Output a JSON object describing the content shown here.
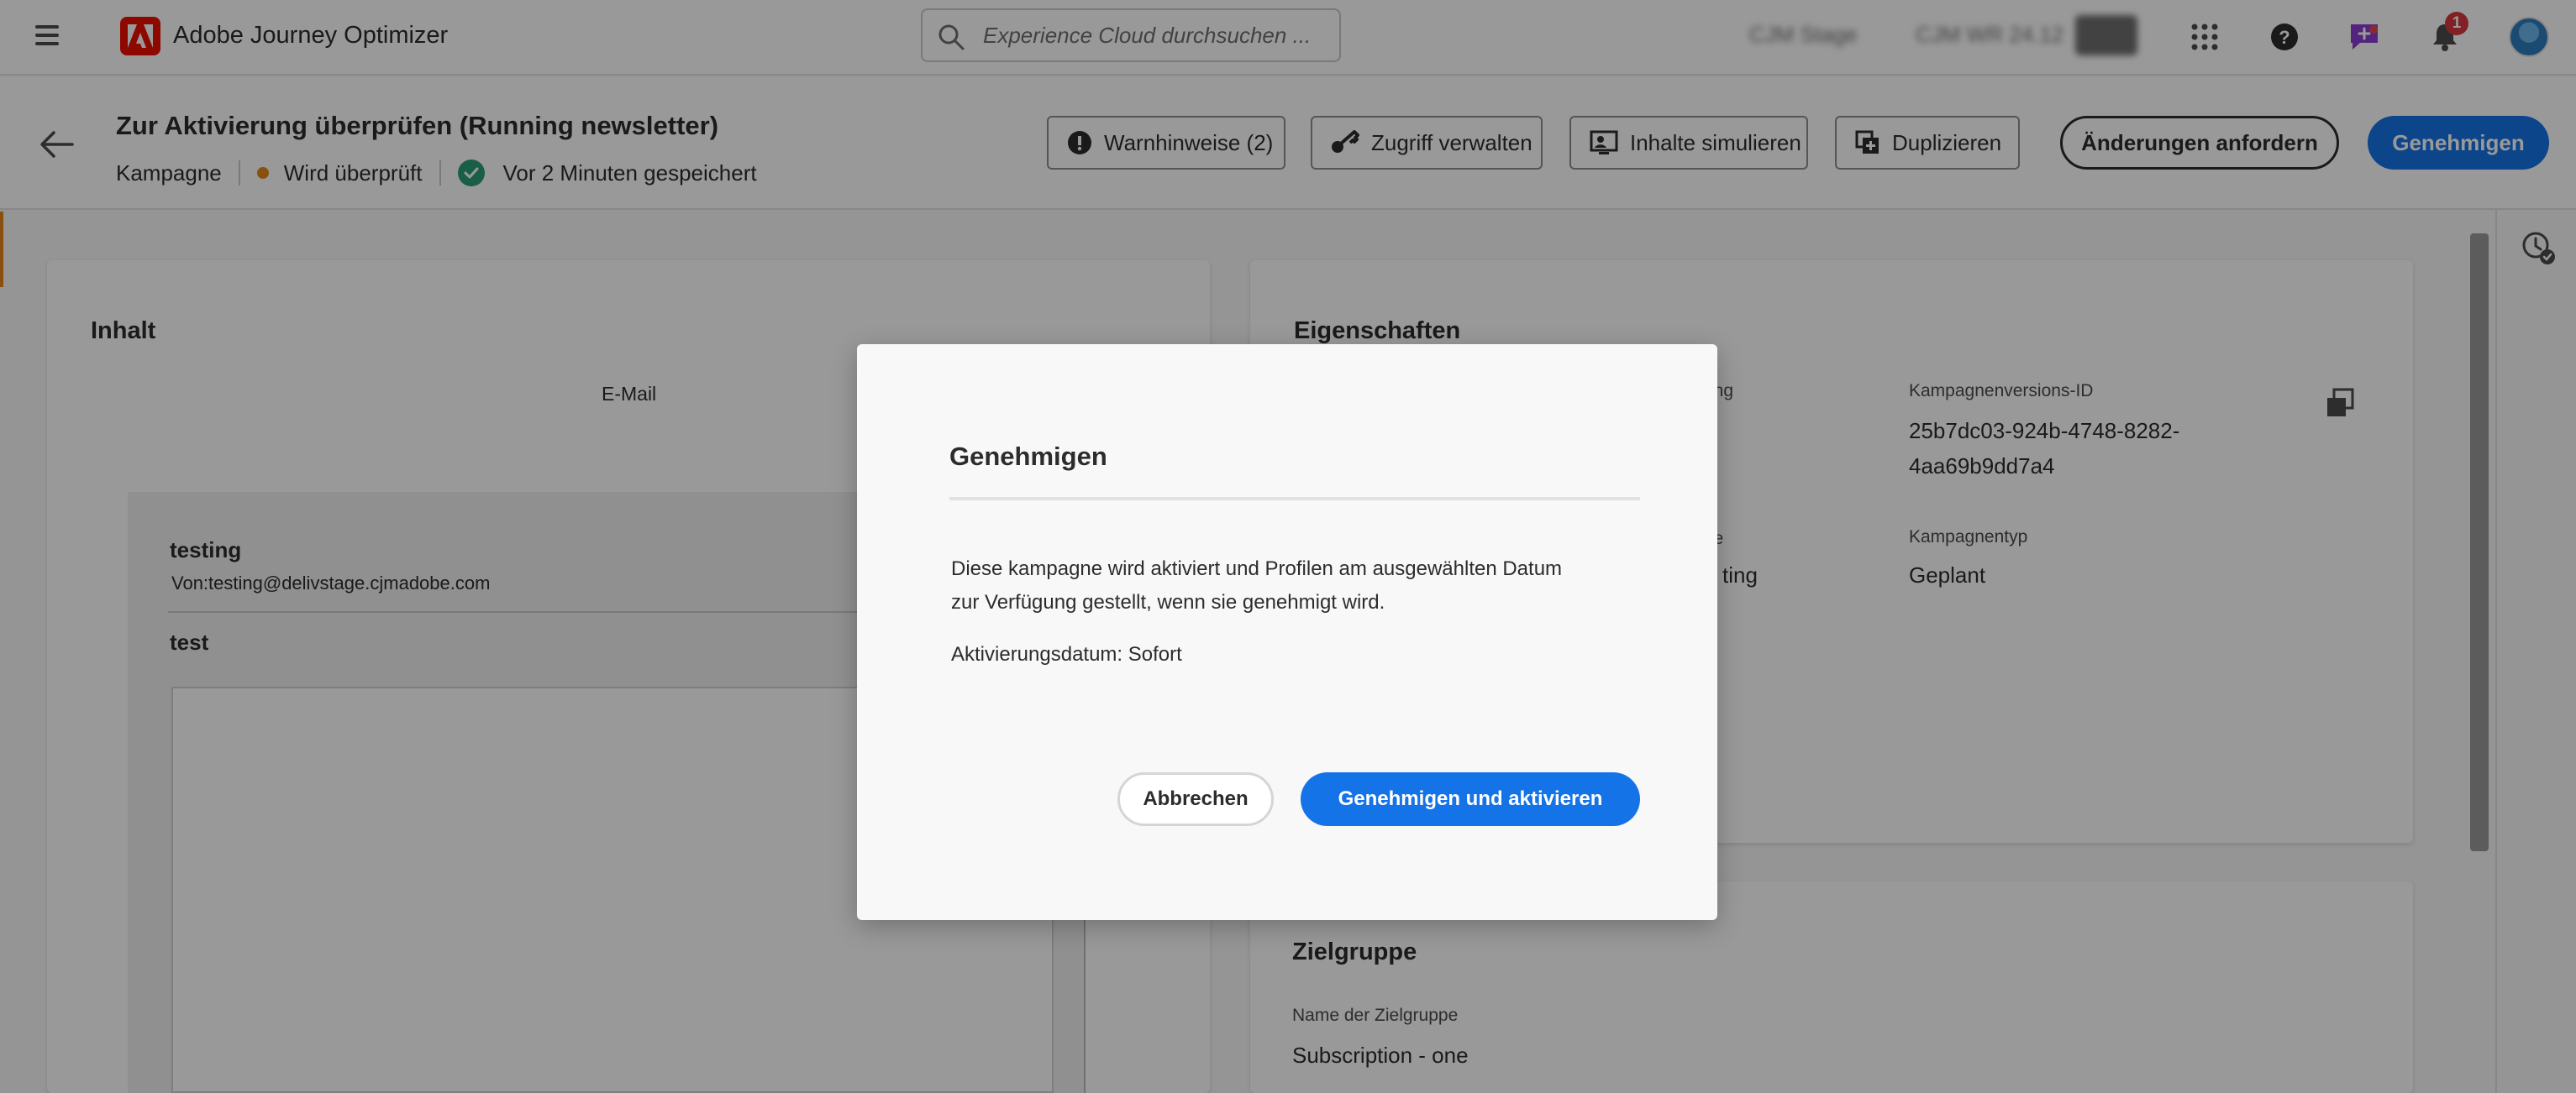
{
  "topbar": {
    "app_title": "Adobe Journey Optimizer",
    "search_placeholder": "Experience Cloud durchsuchen ...",
    "org_blur_1": "CJM Stage",
    "org_blur_2": "CJM WR 24.12",
    "notifications_count": "1"
  },
  "header": {
    "title": "Zur Aktivierung überprüfen (Running newsletter)",
    "type": "Kampagne",
    "status": "Wird überprüft",
    "saved": "Vor 2 Minuten gespeichert",
    "buttons": {
      "warnings": "Warnhinweise (2)",
      "access": "Zugriff verwalten",
      "simulate": "Inhalte simulieren",
      "duplicate": "Duplizieren",
      "request_changes": "Änderungen anfordern",
      "approve": "Genehmigen"
    }
  },
  "content": {
    "title": "Inhalt",
    "channel": "E-Mail",
    "sender_name": "testing",
    "sender_from": "Von:testing@delivstage.cjmadobe.com",
    "subject": "test"
  },
  "properties": {
    "title": "Eigenschaften",
    "desc_label_fragment": "ung",
    "category_label_fragment": "rie",
    "category_value_fragment": "ting",
    "version_id_label": "Kampagnenversions-ID",
    "version_id_line1": "25b7dc03-924b-4748-8282-",
    "version_id_line2": "4aa69b9dd7a4",
    "campaign_type_label": "Kampagnentyp",
    "campaign_type_value": "Geplant"
  },
  "audience": {
    "title": "Zielgruppe",
    "name_label": "Name der Zielgruppe",
    "name_value": "Subscription - one"
  },
  "dialog": {
    "title": "Genehmigen",
    "message_line1": "Diese kampagne wird aktiviert und Profilen am ausgewählten Datum",
    "message_line2": "zur Verfügung gestellt, wenn sie genehmigt wird.",
    "activation_date": "Aktivierungsdatum: Sofort",
    "cancel": "Abbrechen",
    "confirm": "Genehmigen und aktivieren"
  },
  "colors": {
    "accent_blue": "#1473e6",
    "adobe_red": "#eb1000",
    "status_orange": "#e68619",
    "saved_green": "#2d9d78"
  }
}
